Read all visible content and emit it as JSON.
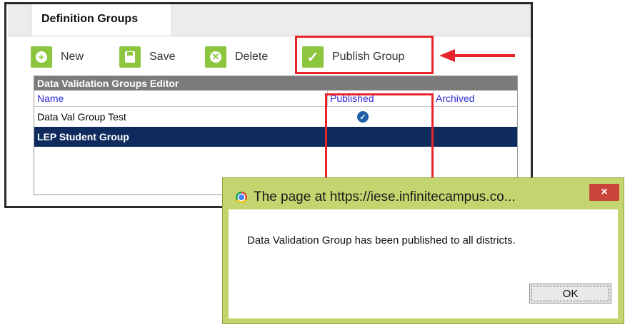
{
  "tab": {
    "label": "Definition Groups"
  },
  "toolbar": {
    "new_label": "New",
    "save_label": "Save",
    "delete_label": "Delete",
    "publish_label": "Publish Group"
  },
  "editor": {
    "title": "Data Validation Groups Editor",
    "columns": [
      "Name",
      "Published",
      "Archived"
    ],
    "rows": [
      {
        "name": "Data Val Group Test",
        "published": true,
        "selected": false
      },
      {
        "name": "LEP Student Group",
        "published": false,
        "selected": true
      }
    ]
  },
  "dialog": {
    "title": "The page at https://iese.infinitecampus.co...",
    "message": "Data Validation Group has been published to all districts.",
    "ok_label": "OK",
    "close_glyph": "×"
  },
  "icons": {
    "new": "plus-icon",
    "save": "floppy-icon",
    "delete": "x-circle-icon",
    "publish": "checkmark-icon",
    "published_check": "check-circle-icon",
    "browser": "chrome-icon"
  },
  "colors": {
    "toolbar_icon_bg": "#8cc63f",
    "highlight": "#e8242b",
    "selected_row": "#0f2b5e",
    "dialog_frame": "#c4d56f",
    "column_header_text": "#2b2bd8"
  }
}
